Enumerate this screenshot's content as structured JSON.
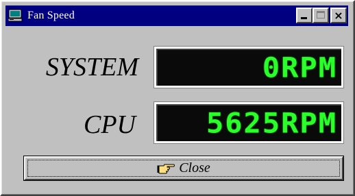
{
  "window": {
    "title": "Fan Speed",
    "title_icon": "computer-icon"
  },
  "title_buttons": {
    "minimize": "minimize-icon",
    "maximize": "maximize-icon",
    "close": "×"
  },
  "readouts": [
    {
      "label": "SYSTEM",
      "value": "0RPM"
    },
    {
      "label": "CPU",
      "value": "5625RPM"
    }
  ],
  "close_button": {
    "label": "Close",
    "icon": "pointing-hand-icon"
  },
  "colors": {
    "titlebar": "#000080",
    "window_bg": "#c0c0c0",
    "lcd_bg": "#0a0a0a",
    "lcd_text": "#2aff2a"
  }
}
